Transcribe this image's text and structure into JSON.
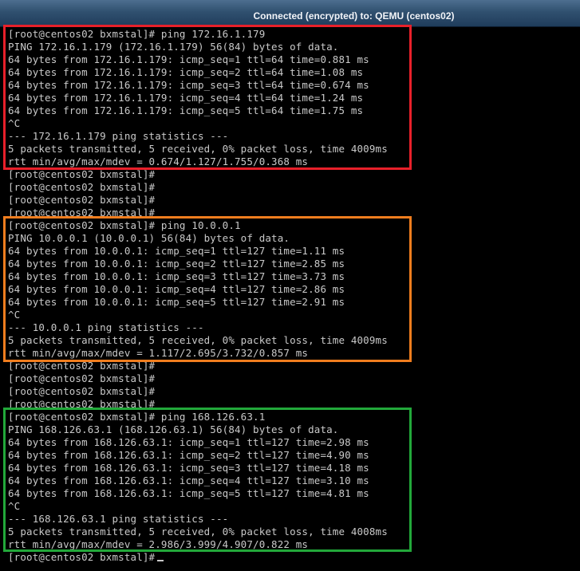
{
  "window": {
    "title": "Connected (encrypted) to: QEMU (centos02)"
  },
  "colors": {
    "highlight_1": "#e8202a",
    "highlight_2": "#f07d1e",
    "highlight_3": "#22a83a",
    "terminal_bg": "#000000",
    "terminal_fg": "#c9c9c9"
  },
  "terminal": {
    "lines": [
      "[root@centos02 bxmstal]# ping 172.16.1.179",
      "PING 172.16.1.179 (172.16.1.179) 56(84) bytes of data.",
      "64 bytes from 172.16.1.179: icmp_seq=1 ttl=64 time=0.881 ms",
      "64 bytes from 172.16.1.179: icmp_seq=2 ttl=64 time=1.08 ms",
      "64 bytes from 172.16.1.179: icmp_seq=3 ttl=64 time=0.674 ms",
      "64 bytes from 172.16.1.179: icmp_seq=4 ttl=64 time=1.24 ms",
      "64 bytes from 172.16.1.179: icmp_seq=5 ttl=64 time=1.75 ms",
      "^C",
      "--- 172.16.1.179 ping statistics ---",
      "5 packets transmitted, 5 received, 0% packet loss, time 4009ms",
      "rtt min/avg/max/mdev = 0.674/1.127/1.755/0.368 ms",
      "[root@centos02 bxmstal]#",
      "[root@centos02 bxmstal]#",
      "[root@centos02 bxmstal]#",
      "[root@centos02 bxmstal]#",
      "[root@centos02 bxmstal]# ping 10.0.0.1",
      "PING 10.0.0.1 (10.0.0.1) 56(84) bytes of data.",
      "64 bytes from 10.0.0.1: icmp_seq=1 ttl=127 time=1.11 ms",
      "64 bytes from 10.0.0.1: icmp_seq=2 ttl=127 time=2.85 ms",
      "64 bytes from 10.0.0.1: icmp_seq=3 ttl=127 time=3.73 ms",
      "64 bytes from 10.0.0.1: icmp_seq=4 ttl=127 time=2.86 ms",
      "64 bytes from 10.0.0.1: icmp_seq=5 ttl=127 time=2.91 ms",
      "^C",
      "--- 10.0.0.1 ping statistics ---",
      "5 packets transmitted, 5 received, 0% packet loss, time 4009ms",
      "rtt min/avg/max/mdev = 1.117/2.695/3.732/0.857 ms",
      "[root@centos02 bxmstal]#",
      "[root@centos02 bxmstal]#",
      "[root@centos02 bxmstal]#",
      "[root@centos02 bxmstal]#",
      "[root@centos02 bxmstal]# ping 168.126.63.1",
      "PING 168.126.63.1 (168.126.63.1) 56(84) bytes of data.",
      "64 bytes from 168.126.63.1: icmp_seq=1 ttl=127 time=2.98 ms",
      "64 bytes from 168.126.63.1: icmp_seq=2 ttl=127 time=4.90 ms",
      "64 bytes from 168.126.63.1: icmp_seq=3 ttl=127 time=4.18 ms",
      "64 bytes from 168.126.63.1: icmp_seq=4 ttl=127 time=3.10 ms",
      "64 bytes from 168.126.63.1: icmp_seq=5 ttl=127 time=4.81 ms",
      "^C",
      "--- 168.126.63.1 ping statistics ---",
      "5 packets transmitted, 5 received, 0% packet loss, time 4008ms",
      "rtt min/avg/max/mdev = 2.986/3.999/4.907/0.822 ms",
      "[root@centos02 bxmstal]#"
    ]
  }
}
